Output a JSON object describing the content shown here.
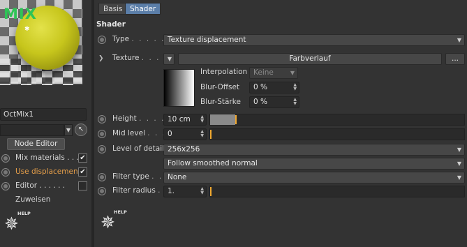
{
  "left": {
    "preview_label": "MIX",
    "material_name": "OctMix1",
    "node_editor_label": "Node Editor",
    "options": [
      {
        "label": "Mix materials . . .",
        "checked": true,
        "highlight": false
      },
      {
        "label": "Use displacement",
        "checked": true,
        "highlight": true
      },
      {
        "label": "Editor . . . . . .",
        "checked": false,
        "highlight": false
      }
    ],
    "assign_label": "Zuweisen",
    "help_label": "HELP"
  },
  "tabs": [
    {
      "label": "Basis",
      "active": false
    },
    {
      "label": "Shader",
      "active": true
    }
  ],
  "section_title": "Shader",
  "type": {
    "label": "Type",
    "dots": ". . . . . .",
    "value": "Texture displacement"
  },
  "texture": {
    "label": "Texture",
    "dots": ". . . .",
    "shader_name": "Farbverlauf",
    "more": "...",
    "interpolation": {
      "label": "Interpolation",
      "value": "Keine"
    },
    "blur_offset": {
      "label": "Blur-Offset",
      "value": "0 %"
    },
    "blur_strength": {
      "label": "Blur-Stärke",
      "value": "0 %"
    }
  },
  "height": {
    "label": "Height",
    "dots": ". . . .",
    "value": "10 cm",
    "slider_fraction": 0.1
  },
  "mid_level": {
    "label": "Mid level",
    "dots": ". . .",
    "value": "0",
    "slider_fraction": 0.0
  },
  "level_of_detail": {
    "label": "Level of detail",
    "value": "256x256",
    "normal_mode": "Follow smoothed normal"
  },
  "filter_type": {
    "label": "Filter type",
    "dots": ". .",
    "value": "None"
  },
  "filter_radius": {
    "label": "Filter radius",
    "dots": ".",
    "value": "1.",
    "slider_fraction": 0.0
  },
  "help_label": "HELP",
  "colors": {
    "accent": "#5b7ea8",
    "slider_marker": "#f0a830",
    "highlight_text": "#e8a04a"
  }
}
